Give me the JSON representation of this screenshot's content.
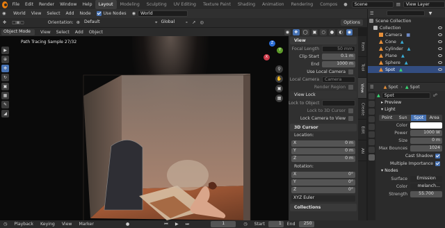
{
  "menu": [
    "File",
    "Edit",
    "Render",
    "Window",
    "Help"
  ],
  "workspaces": [
    "Layout",
    "Modeling",
    "Sculpting",
    "UV Editing",
    "Texture Paint",
    "Shading",
    "Animation",
    "Rendering",
    "Compos"
  ],
  "active_workspace": "Layout",
  "scene_name": "Scene",
  "view_layer": "View Layer",
  "header": {
    "editor_type": "World",
    "view": "View",
    "select": "Select",
    "add": "Add",
    "node": "Node",
    "use_nodes": "Use Nodes",
    "world_name": "World"
  },
  "toolbar2": {
    "orientation_label": "Orientation:",
    "orientation_value": "Default",
    "transform_orientation": "Global",
    "options": "Options"
  },
  "viewport_header": {
    "mode": "Object Mode",
    "view": "View",
    "select": "Select",
    "add": "Add",
    "object": "Object"
  },
  "viewport": {
    "render_status": "Path Tracing Sample 27/32",
    "gizmo": {
      "z": "Z",
      "y": "Y",
      "x": "X"
    }
  },
  "npanel": {
    "view_title": "View",
    "focal_length_label": "Focal Length",
    "focal_length": "50 mm",
    "clip_start_label": "Clip Start",
    "clip_start": "0.1 m",
    "end_label": "End",
    "end": "1000 m",
    "use_local_camera": "Use Local Camera",
    "local_camera_label": "Local Camera",
    "local_camera_value": "Camera",
    "render_region": "Render Region",
    "view_lock_title": "View Lock",
    "lock_to_object": "Lock to Object",
    "lock_to_3d_cursor": "Lock to 3D Cursor",
    "lock_camera_to_view": "Lock Camera to View",
    "cursor_title": "3D Cursor",
    "location_label": "Location:",
    "loc": [
      {
        "axis": "X",
        "val": "0 m"
      },
      {
        "axis": "Y",
        "val": "0 m"
      },
      {
        "axis": "Z",
        "val": "0 m"
      }
    ],
    "rotation_label": "Rotation:",
    "rot": [
      {
        "axis": "X",
        "val": "0°"
      },
      {
        "axis": "Y",
        "val": "0°"
      },
      {
        "axis": "Z",
        "val": "0°"
      }
    ],
    "rotation_mode": "XYZ Euler",
    "collections_title": "Collections"
  },
  "sidebar_tabs": [
    "Item",
    "Tool",
    "View",
    "Create",
    "Edit",
    "AN"
  ],
  "active_sidebar_tab": "View",
  "outliner": {
    "root": "Scene Collection",
    "collection": "Collection",
    "items": [
      {
        "name": "Camera",
        "icon_color": "#6e8ac5"
      },
      {
        "name": "Cone",
        "icon_color": "#e58f3a"
      },
      {
        "name": "Cylinder",
        "icon_color": "#e58f3a"
      },
      {
        "name": "Plane",
        "icon_color": "#e58f3a"
      },
      {
        "name": "Sphere",
        "icon_color": "#e58f3a"
      },
      {
        "name": "Spot",
        "icon_color": "#e5c23a"
      }
    ],
    "selected": "Spot"
  },
  "properties": {
    "header_obj": "Spot",
    "header_data": "Spot",
    "data_name": "Spot",
    "preview": "Preview",
    "light_section": "Light",
    "light_types": [
      "Point",
      "Sun",
      "Spot",
      "Area"
    ],
    "active_light_type": "Spot",
    "color_label": "Color",
    "power_label": "Power",
    "power": "1000 W",
    "size_label": "Size",
    "size": "0 m",
    "max_bounces_label": "Max Bounces",
    "max_bounces": "1024",
    "cast_shadow": "Cast Shadow",
    "multiple_importance": "Multiple Importance",
    "nodes_section": "Nodes",
    "surface_label": "Surface",
    "surface_value": "Emission",
    "node_color_label": "Color",
    "node_color_value": "melanch...",
    "strength_label": "Strength",
    "strength": "55.700"
  },
  "timeline": {
    "playback": "Playback",
    "keying": "Keying",
    "view": "View",
    "marker": "Marker",
    "current_frame": "1",
    "start_label": "Start",
    "start": "1",
    "end_label": "End",
    "end": "250"
  },
  "colors": {
    "accent": "#4772b3",
    "orange": "#e87d0d"
  }
}
